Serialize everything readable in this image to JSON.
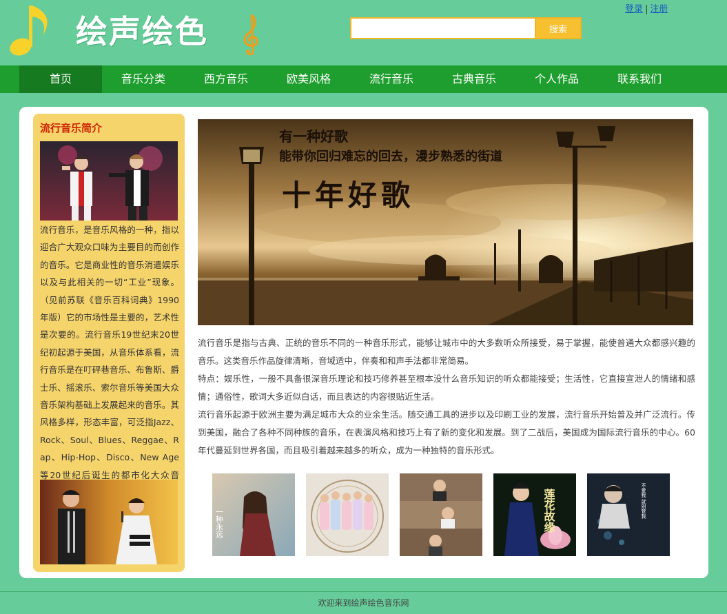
{
  "header": {
    "site_title": "绘声绘色",
    "search_placeholder": "",
    "search_button": "搜索",
    "login": "登录",
    "separator": "|",
    "register": "注册"
  },
  "nav": {
    "items": [
      "首页",
      "音乐分类",
      "西方音乐",
      "欧美风格",
      "流行音乐",
      "古典音乐",
      "个人作品",
      "联系我们"
    ],
    "active_index": 0
  },
  "sidebar": {
    "title": "流行音乐简介",
    "text": "流行音乐，是音乐风格的一种，指以迎合广大观众口味为主要目的而创作的音乐。它是商业性的音乐消遣娱乐以及与此相关的一切“工业”现象。（见前苏联《音乐百科词典》1990年版）它的市场性是主要的，艺术性是次要的。流行音乐19世纪末20世纪初起源于美国，从音乐体系看，流行音乐是在叮砰巷音乐、布鲁斯、爵士乐、摇滚乐、索尔音乐等美国大众音乐架构基础上发展起来的音乐。其风格多样，形态丰富，可泛指Jazz、Rock、Soul、Blues、Reggae、Rap、Hip-Hop、Disco、New Age等20世纪后诞生的都市化大众音乐。"
  },
  "banner": {
    "line1": "有一种好歌",
    "line2": "能带你回归难忘的回去，漫步熟悉的街道",
    "title": "十年好歌"
  },
  "content": {
    "paragraphs": [
      "流行音乐是指与古典、正统的音乐不同的一种音乐形式，能够让城市中的大多数听众所接受，易于掌握，能使普通大众都感兴趣的音乐。这类音乐作品旋律清晰，音域适中，伴奏和和声手法都非常简易。",
      "特点：娱乐性，一般不具备很深音乐理论和技巧修养甚至根本没什么音乐知识的听众都能接受；生活性，它直接宣泄人的情绪和感情；通俗性，歌词大多近似白话，而且表达的内容很贴近生活。",
      "流行音乐起源于欧洲主要为满足城市大众的业余生活。随交通工具的进步以及印刷工业的发展，流行音乐开始普及并广泛流行。传到美国，融合了各种不同种族的音乐，在表演风格和技巧上有了新的变化和发展。到了二战后，美国成为国际流行音乐的中心。60年代蔓延到世界各国，而且吸引着越来越多的听众，成为一种独特的音乐形式。"
    ]
  },
  "albums": {
    "a1_text": "一种永远",
    "a3_text": "",
    "a4_text": "莲花故缘",
    "a5_text": "不爱我 就别管我"
  },
  "footer": {
    "text": "欢迎来到绘声绘色音乐网"
  },
  "colors": {
    "background": "#66cc99",
    "nav": "#1e9e2e",
    "nav_active": "#167a20",
    "sidebar": "#f6d46c",
    "accent_title": "#cc2200",
    "search_button": "#f7c031"
  }
}
